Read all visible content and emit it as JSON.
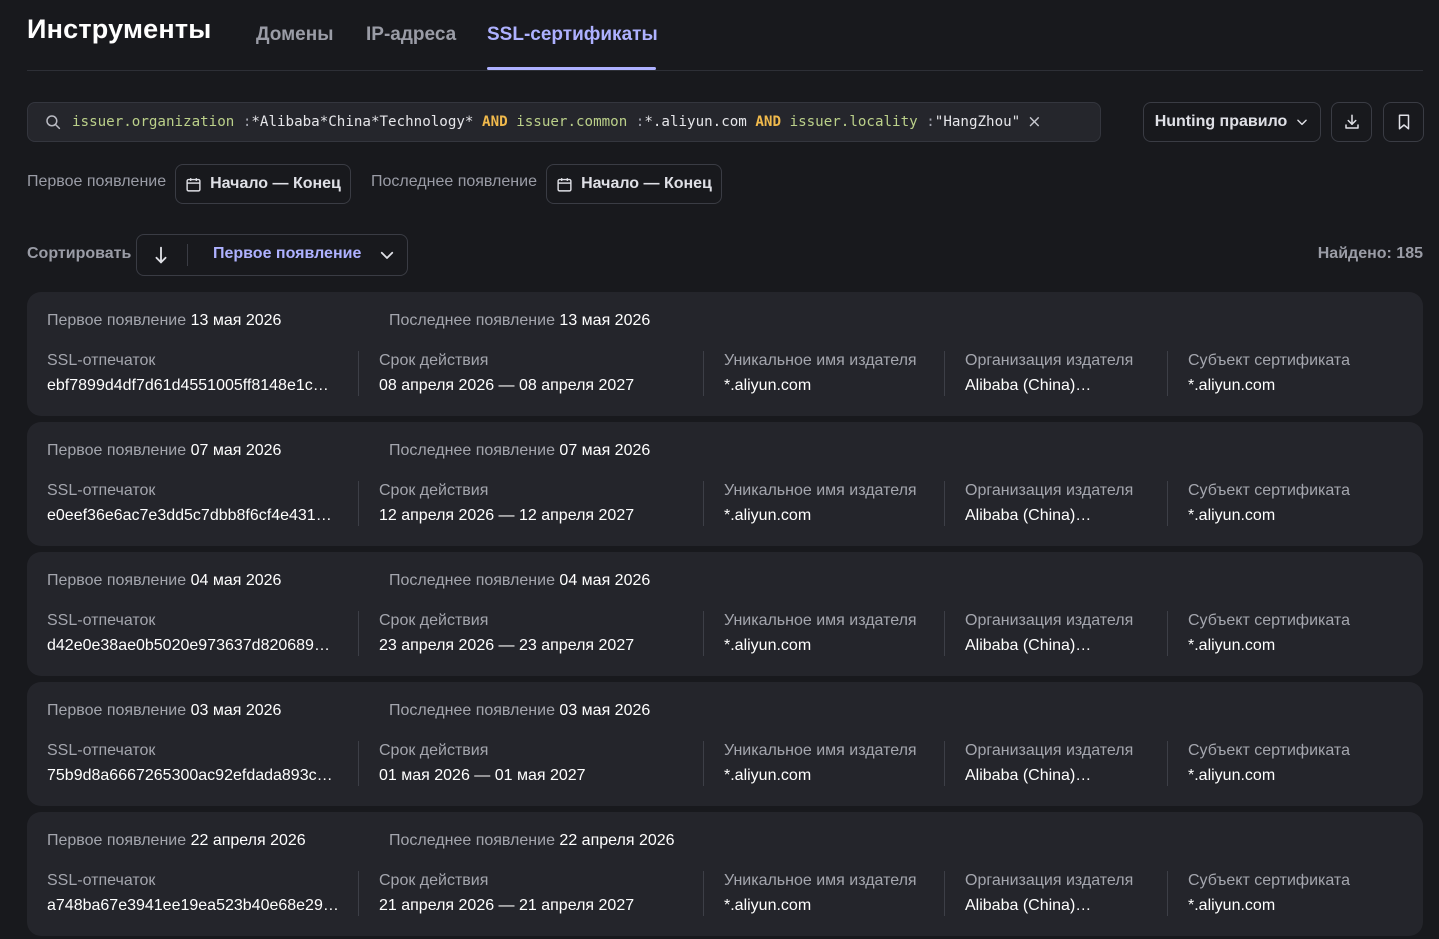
{
  "header": {
    "title": "Инструменты",
    "tabs": [
      {
        "label": "Домены",
        "active": false
      },
      {
        "label": "IP-адреса",
        "active": false
      },
      {
        "label": "SSL-сертификаты",
        "active": true
      }
    ]
  },
  "search": {
    "icon": "search-icon",
    "tokens": [
      {
        "text": "issuer.organization",
        "kind": "field"
      },
      {
        "text": " :",
        "kind": "op"
      },
      {
        "text": "*Alibaba*China*Technology*",
        "kind": "value"
      },
      {
        "text": " AND ",
        "kind": "and"
      },
      {
        "text": "issuer.common",
        "kind": "field"
      },
      {
        "text": " :",
        "kind": "op"
      },
      {
        "text": "*.aliyun.com",
        "kind": "value"
      },
      {
        "text": " AND ",
        "kind": "and"
      },
      {
        "text": "issuer.locality",
        "kind": "field"
      },
      {
        "text": " :",
        "kind": "op"
      },
      {
        "text": "\"HangZhou\"",
        "kind": "value"
      }
    ],
    "clear": "×"
  },
  "toolbar": {
    "hunting_label": "Hunting правило",
    "download_icon": "download-icon",
    "bookmark_icon": "bookmark-icon"
  },
  "filters": {
    "first_seen_label": "Первое появление",
    "last_seen_label": "Последнее появление",
    "range_label": "Начало — Конец"
  },
  "sort": {
    "label": "Сортировать",
    "field": "Первое появление",
    "direction": "desc"
  },
  "found": "Найдено: 185",
  "card_labels": {
    "first_seen": "Первое появление",
    "last_seen": "Последнее появление",
    "fingerprint": "SSL-отпечаток",
    "validity": "Срок действия",
    "issuer_cn": "Уникальное имя издателя",
    "issuer_org": "Организация издателя",
    "subject": "Субъект сертификата"
  },
  "certificates": [
    {
      "first_seen": "13 мая 2026",
      "last_seen": "13 мая 2026",
      "fingerprint": "ebf7899d4df7d61d4551005ff8148e1c…",
      "validity": "08 апреля 2026 — 08 апреля 2027",
      "issuer_cn": "*.aliyun.com",
      "issuer_org": "Alibaba (China)…",
      "subject": "*.aliyun.com"
    },
    {
      "first_seen": "07 мая 2026",
      "last_seen": "07 мая 2026",
      "fingerprint": "e0eef36e6ac7e3dd5c7dbb8f6cf4e431…",
      "validity": "12 апреля 2026 — 12 апреля 2027",
      "issuer_cn": "*.aliyun.com",
      "issuer_org": "Alibaba (China)…",
      "subject": "*.aliyun.com"
    },
    {
      "first_seen": "04 мая 2026",
      "last_seen": "04 мая 2026",
      "fingerprint": "d42e0e38ae0b5020e973637d820689…",
      "validity": "23 апреля 2026 — 23 апреля 2027",
      "issuer_cn": "*.aliyun.com",
      "issuer_org": "Alibaba (China)…",
      "subject": "*.aliyun.com"
    },
    {
      "first_seen": "03 мая 2026",
      "last_seen": "03 мая 2026",
      "fingerprint": "75b9d8a6667265300ac92efdada893c…",
      "validity": "01 мая 2026 — 01 мая 2027",
      "issuer_cn": "*.aliyun.com",
      "issuer_org": "Alibaba (China)…",
      "subject": "*.aliyun.com"
    },
    {
      "first_seen": "22 апреля 2026",
      "last_seen": "22 апреля 2026",
      "fingerprint": "a748ba67e3941ee19ea523b40e68e29…",
      "validity": "21 апреля 2026 — 21 апреля 2027",
      "issuer_cn": "*.aliyun.com",
      "issuer_org": "Alibaba (China)…",
      "subject": "*.aliyun.com"
    }
  ],
  "colors": {
    "background": "#18191d",
    "card": "#24252b",
    "accent": "#aeb1ff",
    "query_field": "#bbd08a",
    "query_value": "#8fa8ff",
    "query_and": "#f0b94c"
  }
}
